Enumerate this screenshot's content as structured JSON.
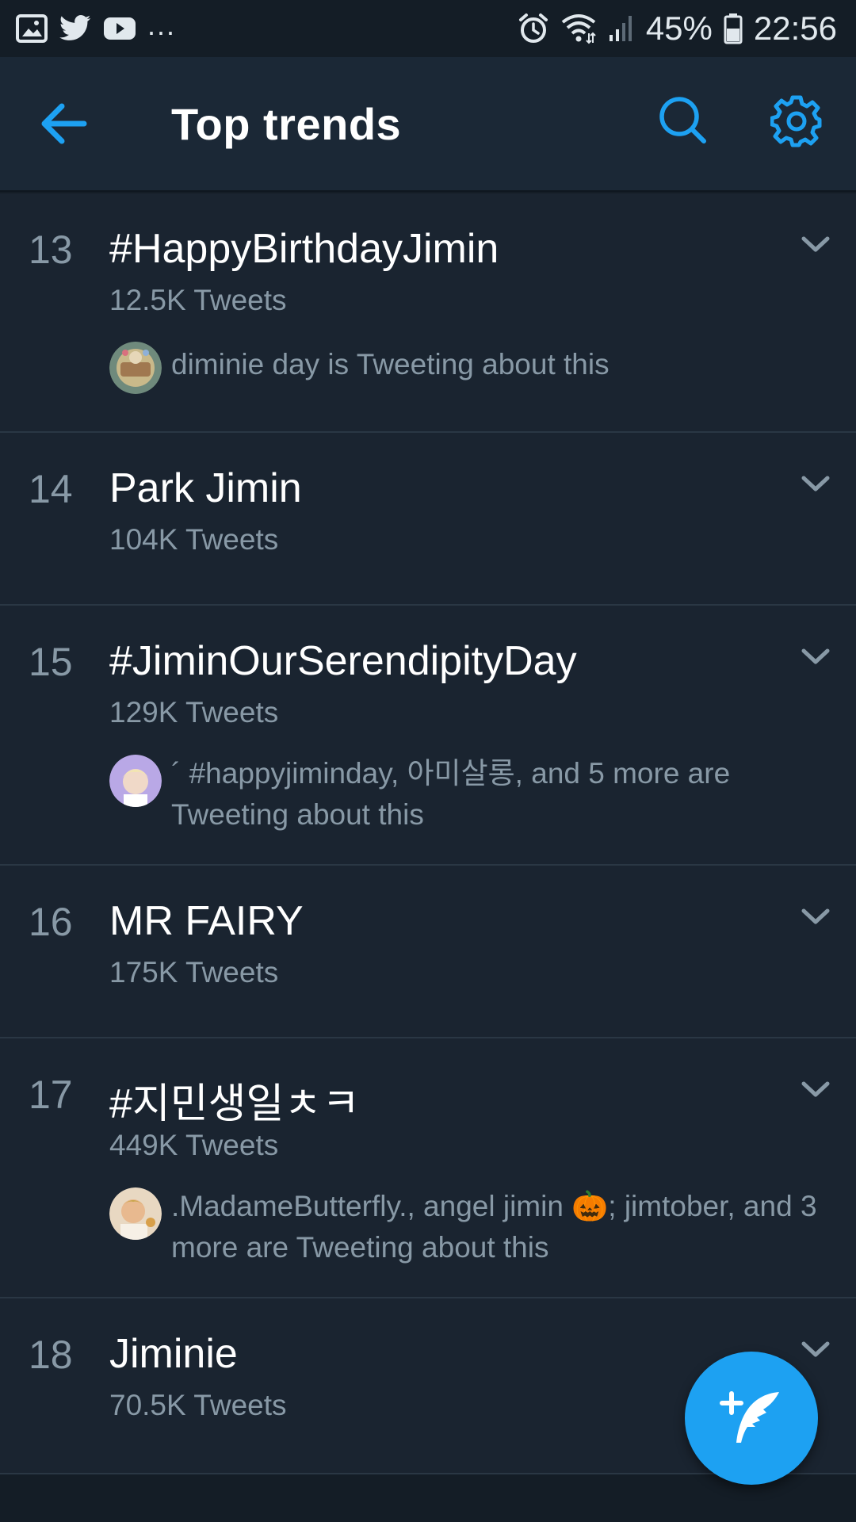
{
  "status_bar": {
    "battery": "45%",
    "time": "22:56",
    "overflow": "...",
    "icons": [
      "image-icon",
      "twitter-icon",
      "youtube-icon",
      "alarm-icon",
      "wifi-icon",
      "signal-icon",
      "battery-icon"
    ]
  },
  "header": {
    "title": "Top trends",
    "back_icon": "arrow-left-icon",
    "search_icon": "search-icon",
    "settings_icon": "gear-icon"
  },
  "trends": [
    {
      "rank": "13",
      "name": "#HappyBirthdayJimin",
      "count": "12.5K Tweets",
      "context": "diminie day is Tweeting about this"
    },
    {
      "rank": "14",
      "name": "Park Jimin",
      "count": "104K Tweets",
      "context": ""
    },
    {
      "rank": "15",
      "name": "#JiminOurSerendipityDay",
      "count": "129K Tweets",
      "context": "´ #happyjiminday, 아미살롱, and 5 more are Tweeting about this"
    },
    {
      "rank": "16",
      "name": "MR FAIRY",
      "count": "175K Tweets",
      "context": ""
    },
    {
      "rank": "17",
      "name": "#지민생일ㅊㅋ",
      "count": "449K Tweets",
      "context": ".MadameButterfly., angel jimin 🎃; jimtober, and 3 more are Tweeting about this"
    },
    {
      "rank": "18",
      "name": "Jiminie",
      "count": "70.5K Tweets",
      "context": ""
    }
  ],
  "fab": {
    "icon": "compose-tweet-icon"
  },
  "colors": {
    "accent": "#1da1f2",
    "background": "#141d26",
    "header": "#1b2836",
    "secondary_text": "#8899a6"
  }
}
